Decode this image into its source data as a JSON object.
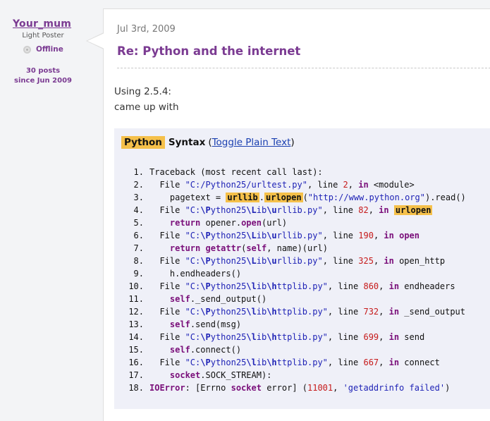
{
  "user": {
    "name": "Your_mum",
    "rank": "Light Poster",
    "status": "Offline",
    "posts": "30 posts",
    "since": "since Jun 2009"
  },
  "post": {
    "date": "Jul 3rd, 2009",
    "title": "Re: Python and the internet",
    "body_lines": [
      "Using 2.5.4:",
      "came up with"
    ]
  },
  "code": {
    "language": "Python",
    "syntax_label": "Syntax",
    "toggle_label": "Toggle Plain Text",
    "lines": [
      {
        "n": "1.",
        "indent": 0,
        "tokens": [
          {
            "t": "Traceback (most recent call last):",
            "c": "plain"
          }
        ]
      },
      {
        "n": "2.",
        "indent": 1,
        "tokens": [
          {
            "t": "File ",
            "c": "plain"
          },
          {
            "t": "\"C:/Python25/urltest.py\"",
            "c": "str"
          },
          {
            "t": ", line ",
            "c": "plain"
          },
          {
            "t": "2",
            "c": "num"
          },
          {
            "t": ", ",
            "c": "plain"
          },
          {
            "t": "in",
            "c": "kw"
          },
          {
            "t": " <module>",
            "c": "plain"
          }
        ]
      },
      {
        "n": "3.",
        "indent": 2,
        "tokens": [
          {
            "t": "pagetext = ",
            "c": "plain"
          },
          {
            "t": "urllib",
            "c": "hl"
          },
          {
            "t": ".",
            "c": "plain"
          },
          {
            "t": "urlopen",
            "c": "hl"
          },
          {
            "t": "(",
            "c": "plain"
          },
          {
            "t": "\"http://www.python.org\"",
            "c": "str"
          },
          {
            "t": ").read()",
            "c": "plain"
          }
        ]
      },
      {
        "n": "4.",
        "indent": 1,
        "tokens": [
          {
            "t": "File ",
            "c": "plain"
          },
          {
            "t": "\"C:",
            "c": "str"
          },
          {
            "t": "\\P",
            "c": "esc"
          },
          {
            "t": "ython25",
            "c": "str"
          },
          {
            "t": "\\L",
            "c": "esc"
          },
          {
            "t": "ib",
            "c": "str"
          },
          {
            "t": "\\u",
            "c": "esc"
          },
          {
            "t": "rllib.py\"",
            "c": "str"
          },
          {
            "t": ", line ",
            "c": "plain"
          },
          {
            "t": "82",
            "c": "num"
          },
          {
            "t": ", ",
            "c": "plain"
          },
          {
            "t": "in",
            "c": "kw"
          },
          {
            "t": " ",
            "c": "plain"
          },
          {
            "t": "urlopen",
            "c": "hl"
          }
        ]
      },
      {
        "n": "5.",
        "indent": 2,
        "tokens": [
          {
            "t": "return",
            "c": "kw"
          },
          {
            "t": " opener.",
            "c": "plain"
          },
          {
            "t": "open",
            "c": "kw"
          },
          {
            "t": "(url)",
            "c": "plain"
          }
        ]
      },
      {
        "n": "6.",
        "indent": 1,
        "tokens": [
          {
            "t": "File ",
            "c": "plain"
          },
          {
            "t": "\"C:",
            "c": "str"
          },
          {
            "t": "\\P",
            "c": "esc"
          },
          {
            "t": "ython25",
            "c": "str"
          },
          {
            "t": "\\L",
            "c": "esc"
          },
          {
            "t": "ib",
            "c": "str"
          },
          {
            "t": "\\u",
            "c": "esc"
          },
          {
            "t": "rllib.py\"",
            "c": "str"
          },
          {
            "t": ", line ",
            "c": "plain"
          },
          {
            "t": "190",
            "c": "num"
          },
          {
            "t": ", ",
            "c": "plain"
          },
          {
            "t": "in",
            "c": "kw"
          },
          {
            "t": " ",
            "c": "plain"
          },
          {
            "t": "open",
            "c": "kw"
          }
        ]
      },
      {
        "n": "7.",
        "indent": 2,
        "tokens": [
          {
            "t": "return",
            "c": "kw"
          },
          {
            "t": " ",
            "c": "plain"
          },
          {
            "t": "getattr",
            "c": "kw"
          },
          {
            "t": "(",
            "c": "plain"
          },
          {
            "t": "self",
            "c": "kw"
          },
          {
            "t": ", name)(url)",
            "c": "plain"
          }
        ]
      },
      {
        "n": "8.",
        "indent": 1,
        "tokens": [
          {
            "t": "File ",
            "c": "plain"
          },
          {
            "t": "\"C:",
            "c": "str"
          },
          {
            "t": "\\P",
            "c": "esc"
          },
          {
            "t": "ython25",
            "c": "str"
          },
          {
            "t": "\\L",
            "c": "esc"
          },
          {
            "t": "ib",
            "c": "str"
          },
          {
            "t": "\\u",
            "c": "esc"
          },
          {
            "t": "rllib.py\"",
            "c": "str"
          },
          {
            "t": ", line ",
            "c": "plain"
          },
          {
            "t": "325",
            "c": "num"
          },
          {
            "t": ", ",
            "c": "plain"
          },
          {
            "t": "in",
            "c": "kw"
          },
          {
            "t": " open_http",
            "c": "plain"
          }
        ]
      },
      {
        "n": "9.",
        "indent": 2,
        "tokens": [
          {
            "t": "h.endheaders()",
            "c": "plain"
          }
        ]
      },
      {
        "n": "10.",
        "indent": 1,
        "tokens": [
          {
            "t": "File ",
            "c": "plain"
          },
          {
            "t": "\"C:",
            "c": "str"
          },
          {
            "t": "\\P",
            "c": "esc"
          },
          {
            "t": "ython25",
            "c": "str"
          },
          {
            "t": "\\l",
            "c": "esc"
          },
          {
            "t": "ib",
            "c": "str"
          },
          {
            "t": "\\h",
            "c": "esc"
          },
          {
            "t": "ttplib.py\"",
            "c": "str"
          },
          {
            "t": ", line ",
            "c": "plain"
          },
          {
            "t": "860",
            "c": "num"
          },
          {
            "t": ", ",
            "c": "plain"
          },
          {
            "t": "in",
            "c": "kw"
          },
          {
            "t": " endheaders",
            "c": "plain"
          }
        ]
      },
      {
        "n": "11.",
        "indent": 2,
        "tokens": [
          {
            "t": "self",
            "c": "kw"
          },
          {
            "t": "._send_output()",
            "c": "plain"
          }
        ]
      },
      {
        "n": "12.",
        "indent": 1,
        "tokens": [
          {
            "t": "File ",
            "c": "plain"
          },
          {
            "t": "\"C:",
            "c": "str"
          },
          {
            "t": "\\P",
            "c": "esc"
          },
          {
            "t": "ython25",
            "c": "str"
          },
          {
            "t": "\\l",
            "c": "esc"
          },
          {
            "t": "ib",
            "c": "str"
          },
          {
            "t": "\\h",
            "c": "esc"
          },
          {
            "t": "ttplib.py\"",
            "c": "str"
          },
          {
            "t": ", line ",
            "c": "plain"
          },
          {
            "t": "732",
            "c": "num"
          },
          {
            "t": ", ",
            "c": "plain"
          },
          {
            "t": "in",
            "c": "kw"
          },
          {
            "t": " _send_output",
            "c": "plain"
          }
        ]
      },
      {
        "n": "13.",
        "indent": 2,
        "tokens": [
          {
            "t": "self",
            "c": "kw"
          },
          {
            "t": ".send(msg)",
            "c": "plain"
          }
        ]
      },
      {
        "n": "14.",
        "indent": 1,
        "tokens": [
          {
            "t": "File ",
            "c": "plain"
          },
          {
            "t": "\"C:",
            "c": "str"
          },
          {
            "t": "\\P",
            "c": "esc"
          },
          {
            "t": "ython25",
            "c": "str"
          },
          {
            "t": "\\l",
            "c": "esc"
          },
          {
            "t": "ib",
            "c": "str"
          },
          {
            "t": "\\h",
            "c": "esc"
          },
          {
            "t": "ttplib.py\"",
            "c": "str"
          },
          {
            "t": ", line ",
            "c": "plain"
          },
          {
            "t": "699",
            "c": "num"
          },
          {
            "t": ", ",
            "c": "plain"
          },
          {
            "t": "in",
            "c": "kw"
          },
          {
            "t": " send",
            "c": "plain"
          }
        ]
      },
      {
        "n": "15.",
        "indent": 2,
        "tokens": [
          {
            "t": "self",
            "c": "kw"
          },
          {
            "t": ".connect()",
            "c": "plain"
          }
        ]
      },
      {
        "n": "16.",
        "indent": 1,
        "tokens": [
          {
            "t": "File ",
            "c": "plain"
          },
          {
            "t": "\"C:",
            "c": "str"
          },
          {
            "t": "\\P",
            "c": "esc"
          },
          {
            "t": "ython25",
            "c": "str"
          },
          {
            "t": "\\l",
            "c": "esc"
          },
          {
            "t": "ib",
            "c": "str"
          },
          {
            "t": "\\h",
            "c": "esc"
          },
          {
            "t": "ttplib.py\"",
            "c": "str"
          },
          {
            "t": ", line ",
            "c": "plain"
          },
          {
            "t": "667",
            "c": "num"
          },
          {
            "t": ", ",
            "c": "plain"
          },
          {
            "t": "in",
            "c": "kw"
          },
          {
            "t": " connect",
            "c": "plain"
          }
        ]
      },
      {
        "n": "17.",
        "indent": 2,
        "tokens": [
          {
            "t": "socket",
            "c": "kw"
          },
          {
            "t": ".SOCK_STREAM):",
            "c": "plain"
          }
        ]
      },
      {
        "n": "18.",
        "indent": 0,
        "tokens": [
          {
            "t": "IOError",
            "c": "cls"
          },
          {
            "t": ": [Errno ",
            "c": "plain"
          },
          {
            "t": "socket",
            "c": "kw"
          },
          {
            "t": " error] (",
            "c": "plain"
          },
          {
            "t": "11001",
            "c": "num"
          },
          {
            "t": ", ",
            "c": "plain"
          },
          {
            "t": "'getaddrinfo failed'",
            "c": "str"
          },
          {
            "t": ")",
            "c": "plain"
          }
        ]
      }
    ]
  }
}
